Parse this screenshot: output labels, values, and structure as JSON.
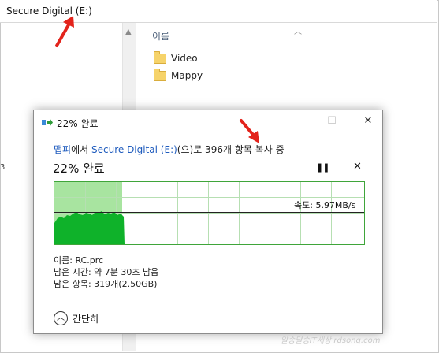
{
  "address_bar": {
    "path": "Secure Digital (E:)"
  },
  "file_list": {
    "column_header": "이름",
    "items": [
      {
        "name": "Video",
        "icon": "folder-icon"
      },
      {
        "name": "Mappy",
        "icon": "folder-icon"
      }
    ]
  },
  "left_pane": {
    "fragment": "3"
  },
  "dialog": {
    "title": "22% 완료",
    "source": "맵피",
    "source_suffix": "에서 ",
    "destination": "Secure Digital (E:)",
    "dest_suffix": "(으)로 396개 항목 복사 중",
    "progress_label": "22% 완료",
    "progress_fraction": 0.22,
    "speed_label": "속도: 5.97MB/s",
    "name_line": "이름: RC.prc",
    "time_left_line": "남은 시간: 약 7분 30초 남음",
    "items_left_line": "남은 항목: 319개(2.50GB)",
    "less_details": "간단히",
    "pause_icon": "pause-icon",
    "cancel_icon": "close-icon",
    "colors": {
      "progress_fill": "#a8e4a0",
      "graph_area": "#0fb22a",
      "link": "#1e5bbd"
    }
  },
  "watermark": "알송달송IT세상 rdsong.com"
}
